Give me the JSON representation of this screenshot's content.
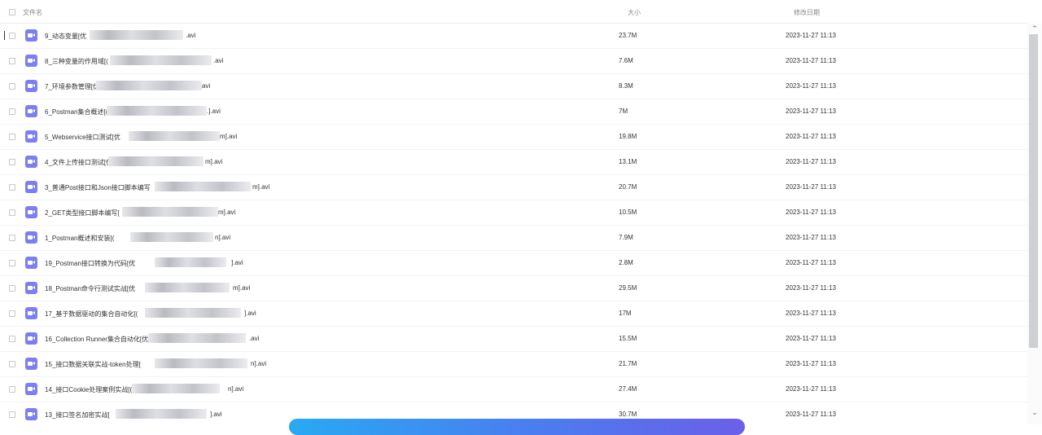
{
  "header": {
    "name_label": "文件名",
    "size_label": "大小",
    "date_label": "修改日期"
  },
  "icons": {
    "file_icon": "video-file-icon",
    "file_icon_color": "#7c7ff0"
  },
  "files": [
    {
      "prefix": "9_动态变量[优",
      "suffix": ".avi",
      "size": "23.7M",
      "date": "2023-11-27 11:13"
    },
    {
      "prefix": "8_三种变量的作用域[(",
      "suffix": ".avi",
      "size": "7.6M",
      "date": "2023-11-27 11:13"
    },
    {
      "prefix": "7_环境参数管理[优",
      "suffix": "avi",
      "size": "8.3M",
      "date": "2023-11-27 11:13"
    },
    {
      "prefix": "6_Postman集合概述[(",
      "suffix": ".].avi",
      "size": "7M",
      "date": "2023-11-27 11:13"
    },
    {
      "prefix": "5_Webservice接口测试[优",
      "suffix": "m].avi",
      "size": "19.8M",
      "date": "2023-11-27 11:13"
    },
    {
      "prefix": "4_文件上传接口测试[优",
      "suffix": "m].avi",
      "size": "13.1M",
      "date": "2023-11-27 11:13"
    },
    {
      "prefix": "3_普通Post接口和Json接口脚本编写",
      "suffix": "m].avi",
      "size": "20.7M",
      "date": "2023-11-27 11:13"
    },
    {
      "prefix": "2_GET类型接口脚本编写[",
      "suffix": "m].avi",
      "size": "10.5M",
      "date": "2023-11-27 11:13"
    },
    {
      "prefix": "1_Postman概述和安装[(",
      "suffix": "n].avi",
      "size": "7.9M",
      "date": "2023-11-27 11:13"
    },
    {
      "prefix": "19_Postman接口转换为代码[优",
      "suffix": "].avi",
      "size": "2.8M",
      "date": "2023-11-27 11:13"
    },
    {
      "prefix": "18_Postman命令行测试实战[优",
      "suffix": "m].avi",
      "size": "29.5M",
      "date": "2023-11-27 11:13"
    },
    {
      "prefix": "17_基于数据驱动的集合自动化[(",
      "suffix": "].avi",
      "size": "17M",
      "date": "2023-11-27 11:13"
    },
    {
      "prefix": "16_Collection Runner集合自动化[优",
      "suffix": ".avi",
      "size": "15.5M",
      "date": "2023-11-27 11:13"
    },
    {
      "prefix": "15_接口数据关联实战-token处理[",
      "suffix": "n].avi",
      "size": "21.7M",
      "date": "2023-11-27 11:13"
    },
    {
      "prefix": "14_接口Cookie处理案例实战[(",
      "suffix": "n].avi",
      "size": "27.4M",
      "date": "2023-11-27 11:13"
    },
    {
      "prefix": "13_接口签名加密实战[",
      "suffix": "].avi",
      "size": "30.7M",
      "date": "2023-11-27 11:13"
    }
  ]
}
